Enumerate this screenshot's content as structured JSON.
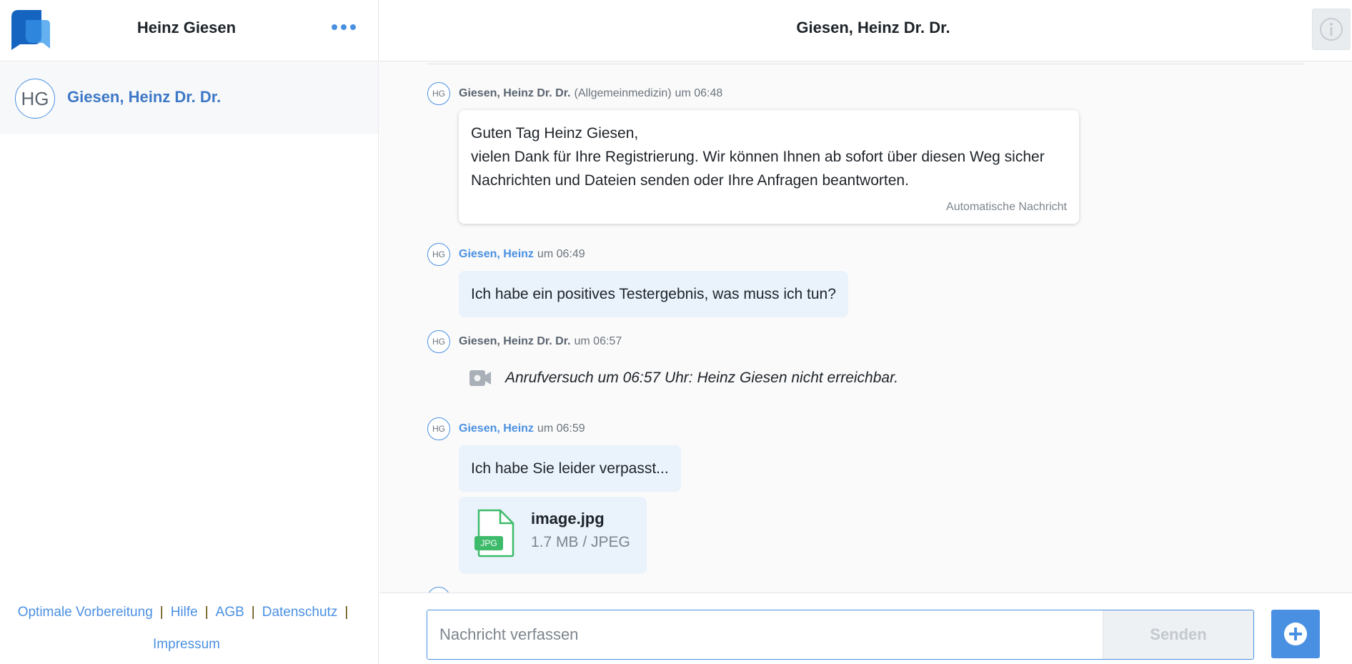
{
  "sidebar": {
    "title": "Heinz Giesen",
    "contact": {
      "initials": "HG",
      "name": "Giesen, Heinz Dr. Dr."
    },
    "footer_links": [
      "Optimale Vorbereitung",
      "Hilfe",
      "AGB",
      "Datenschutz",
      "Impressum"
    ],
    "separator": "|"
  },
  "main": {
    "title": "Giesen, Heinz Dr. Dr."
  },
  "messages": [
    {
      "initials": "HG",
      "sender": "Giesen, Heinz Dr. Dr.",
      "department": "(Allgemeinmedizin)",
      "time": "um 06:48",
      "lines": [
        "Guten Tag Heinz Giesen,",
        "vielen Dank für Ihre Registrierung. Wir können Ihnen ab sofort über diesen Weg sicher",
        "Nachrichten und Dateien senden oder Ihre Anfragen beantworten."
      ],
      "footnote": "Automatische Nachricht"
    },
    {
      "initials": "HG",
      "sender": "Giesen, Heinz",
      "time": "um 06:49",
      "text": "Ich habe ein positives Testergebnis, was muss ich tun?"
    },
    {
      "initials": "HG",
      "sender": "Giesen, Heinz Dr. Dr.",
      "time": "um 06:57",
      "call_text": "Anrufversuch um 06:57 Uhr: Heinz Giesen nicht erreichbar."
    },
    {
      "initials": "HG",
      "sender": "Giesen, Heinz",
      "time": "um 06:59",
      "text": "Ich habe Sie leider verpasst...",
      "file": {
        "name": "image.jpg",
        "size": "1.7 MB / JPEG",
        "badge": "JPG"
      }
    }
  ],
  "composer": {
    "placeholder": "Nachricht verfassen",
    "send_label": "Senden"
  },
  "icons": {
    "logo": "app-logo",
    "more": "more-dots-icon",
    "info": "info-icon",
    "camera": "video-camera-icon",
    "file": "jpg-file-icon",
    "plus": "plus-circle-icon"
  },
  "colors": {
    "accent": "#4a90e2",
    "bubble_patient": "#eaf2fb",
    "file_green": "#3dbb6b"
  }
}
